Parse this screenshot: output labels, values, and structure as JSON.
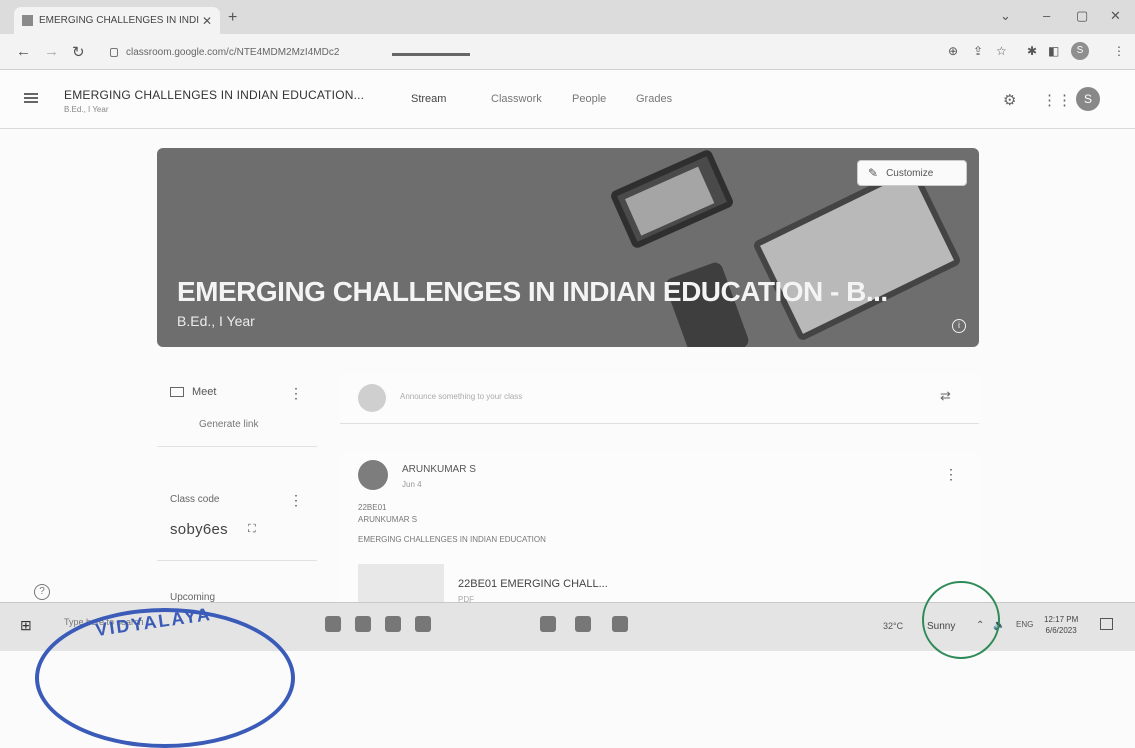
{
  "browser": {
    "tab_title": "EMERGING CHALLENGES IN INDI",
    "url": "classroom.google.com/c/NTE4MDM2MzI4MDc2",
    "profile_initial": "S"
  },
  "header": {
    "class_title": "EMERGING CHALLENGES IN INDIAN EDUCATION...",
    "class_subtitle": "B.Ed., I Year",
    "tabs": [
      {
        "label": "Stream"
      },
      {
        "label": "Classwork"
      },
      {
        "label": "People"
      },
      {
        "label": "Grades"
      }
    ],
    "avatar_initial": "S"
  },
  "banner": {
    "title": "EMERGING CHALLENGES IN INDIAN EDUCATION - B...",
    "subtitle": "B.Ed., I Year",
    "customize_label": "Customize"
  },
  "sidebar": {
    "meet_label": "Meet",
    "generate_link_label": "Generate link",
    "class_code_label": "Class code",
    "class_code_value": "soby6es",
    "upcoming_label": "Upcoming"
  },
  "stream": {
    "announce_placeholder": "Announce something to your class",
    "post": {
      "author": "ARUNKUMAR S",
      "date": "Jun 4",
      "lines": [
        "22BE01",
        "ARUNKUMAR S",
        "EMERGING CHALLENGES IN INDIAN EDUCATION"
      ],
      "attachment_title": "22BE01 EMERGING CHALL...",
      "attachment_type": "PDF"
    }
  },
  "taskbar": {
    "search_placeholder": "Type here to search",
    "temperature": "32°C",
    "weather": "Sunny",
    "language": "ENG",
    "time": "12:17 PM",
    "date": "6/6/2023"
  },
  "stamp": {
    "text": "VIDYALAYA"
  }
}
